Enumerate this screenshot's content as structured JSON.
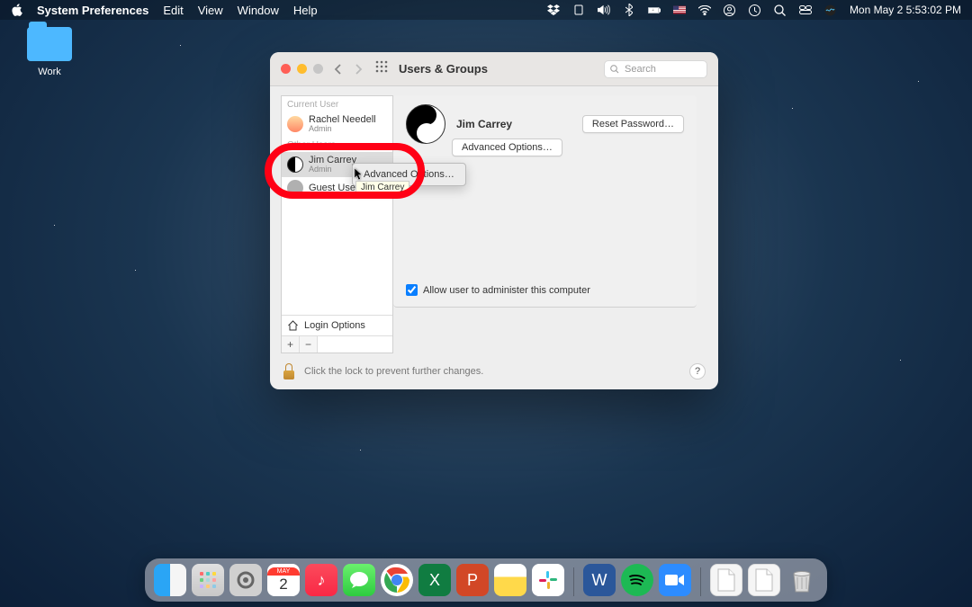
{
  "menubar": {
    "app": "System Preferences",
    "items": [
      "Edit",
      "View",
      "Window",
      "Help"
    ],
    "datetime": "Mon May 2  5:53:02 PM"
  },
  "desktop": {
    "folder_label": "Work"
  },
  "window": {
    "title": "Users & Groups",
    "search_placeholder": "Search",
    "reset_btn": "Reset Password…",
    "advanced_btn": "Advanced Options…",
    "allow_admin": "Allow user to administer this computer",
    "lock_text": "Click the lock to prevent further changes.",
    "login_options": "Login Options"
  },
  "sidebar": {
    "current_header": "Current User",
    "other_header": "Other Users",
    "users": [
      {
        "name": "Rachel Needell",
        "role": "Admin"
      },
      {
        "name": "Jim Carrey",
        "role": "Admin"
      },
      {
        "name": "Guest User",
        "role": ""
      }
    ]
  },
  "selected_user": {
    "name": "Jim Carrey"
  },
  "context_menu": {
    "item": "Advanced Options…"
  },
  "tooltip": "Jim Carrey",
  "dock": {
    "cal_month": "MAY",
    "cal_day": "2"
  }
}
